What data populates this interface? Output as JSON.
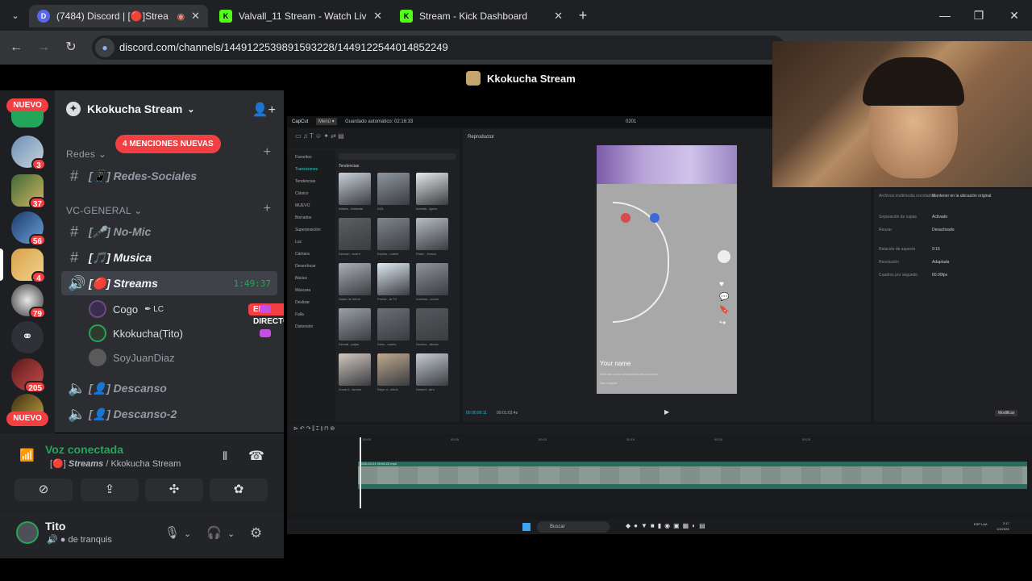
{
  "browser": {
    "tabs": [
      {
        "title": "(7484) Discord | [🔴]Strea"
      },
      {
        "title": "Valvall_11 Stream - Watch Live o"
      },
      {
        "title": "Stream - Kick Dashboard"
      }
    ],
    "url": "discord.com/channels/1449122539891593228/1449122544014852249"
  },
  "rail": {
    "nuevo_top": "NUEVO",
    "nuevo_bottom": "NUEVO",
    "badges": [
      "3",
      "37",
      "56",
      "4",
      "79",
      "205"
    ]
  },
  "sidebar": {
    "server_name": "Kkokucha Stream",
    "mentions_badge": "4 MENCIONES NUEVAS",
    "categories": {
      "redes": "Redes",
      "vc_general": "VC-GENERAL"
    },
    "channels": {
      "redes_sociales": "Redes-Sociales",
      "no_mic": "No-Mic",
      "musica": "Musica",
      "streams": "Streams",
      "descanso": "Descanso",
      "descanso_2": "Descanso-2"
    },
    "streams_timer": "1:49:37",
    "voice_users": [
      {
        "name": "Cogo",
        "tag": "LC"
      },
      {
        "name": "Kkokucha(Tito)"
      },
      {
        "name": "SoyJuanDiaz"
      }
    ],
    "live_badge": "EN DIRECTO"
  },
  "voice": {
    "title": "Voz conectada",
    "channel": "Streams",
    "server": "/ Kkokucha Stream"
  },
  "user": {
    "name": "Tito",
    "status": "de tranquis"
  },
  "stream": {
    "title": "Kkokucha Stream",
    "editor": {
      "save_status": "Guardado automático: 02:16:33",
      "counter": "0201",
      "player_label": "Reproductor",
      "tendencias": "Tendencias",
      "time_current": "00:00:00:11",
      "time_total": "00:01:03:4s",
      "modify_button": "Modificar",
      "phone_name": "Your name",
      "phone_desc": "Here are some descriptions about videos",
      "phone_sound": "See original",
      "media_categories": [
        "Favoritos",
        "Transiciones",
        "Tendencias",
        "Clásico",
        "MUEVO",
        "Borrados",
        "Superposición",
        "Luz",
        "Cámara",
        "Desenfocar",
        "Básico",
        "Máscara",
        "Deslizar",
        "Falla",
        "Distorsión"
      ],
      "thumb_labels": [
        "Inflado...ilimitada",
        "DOL",
        "Inestab...ligero",
        "Desvan...ecent",
        "Explos...nubes",
        "Flash ...fresco",
        "Salón de fútbol",
        "Proble...la TV",
        "Vuelves...conce",
        "Derrad...pajas",
        "Desc...nubes",
        "Deslizo...abrola",
        "Zoom li...lances",
        "Rayo d...nidos",
        "Desenf...atro"
      ],
      "props": [
        {
          "label": "Archivos multimedia recortados",
          "value": "Mantener en la ubicación original"
        },
        {
          "label": "Separación de capas",
          "value": "Activado"
        },
        {
          "label": "Reusar",
          "value": "Desactivado"
        },
        {
          "label": "Relación de aspecto",
          "value": "9:16"
        },
        {
          "label": "Resolución",
          "value": "Adaptada"
        },
        {
          "label": "Cuadros por segundo",
          "value": "60.00fps"
        }
      ],
      "clip_label": "2026-03-01 00:06:22.mp4",
      "ruler": [
        "00:00",
        "00:05",
        "00:10",
        "00:15",
        "00:20",
        "00:25"
      ],
      "taskbar_search": "Buscar",
      "taskbar_lang": "ESP LAA",
      "taskbar_time": "2:17",
      "taskbar_date": "1/3/2026"
    }
  },
  "colors": {
    "discord_green": "#23a55a",
    "discord_red": "#f23f42",
    "kick_green": "#53fc18"
  }
}
